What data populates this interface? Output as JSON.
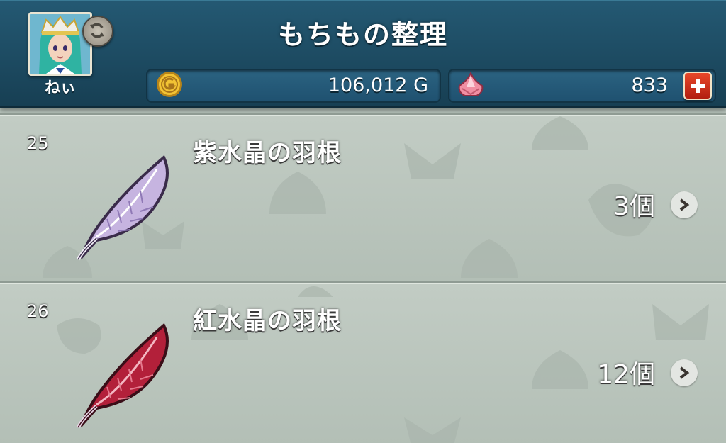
{
  "header": {
    "title": "もちもの整理",
    "player_name": "ねぃ",
    "avatar_icon": "player-avatar",
    "refresh_icon": "refresh-icon"
  },
  "currency": {
    "gold": {
      "icon": "gold-coin-icon",
      "value": "106,012 G"
    },
    "gems": {
      "icon": "gem-icon",
      "value": "833",
      "add_icon": "plus-icon"
    }
  },
  "items": [
    {
      "number": "25",
      "name": "紫水晶の羽根",
      "count": "3個",
      "icon": "purple-feather-icon",
      "color": "#b9a3d4"
    },
    {
      "number": "26",
      "name": "紅水晶の羽根",
      "count": "12個",
      "icon": "red-feather-icon",
      "color": "#b3203a"
    }
  ],
  "colors": {
    "header_bg": "#1d4b62",
    "list_bg": "#b7c3bb",
    "plus_button": "#d23a1f"
  }
}
